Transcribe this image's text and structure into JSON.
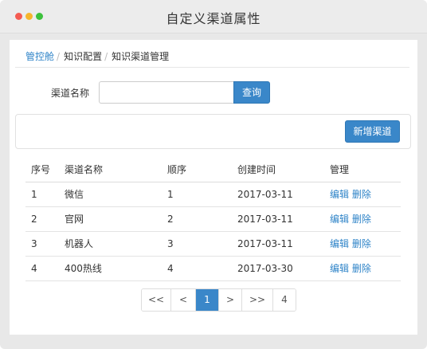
{
  "window": {
    "title": "自定义渠道属性"
  },
  "breadcrumb": {
    "home": "管控舱",
    "sep": "/",
    "level1": "知识配置",
    "current": "知识渠道管理"
  },
  "search": {
    "label": "渠道名称",
    "value": "",
    "placeholder": "",
    "button": "查询"
  },
  "toolbar": {
    "add_label": "新增渠道"
  },
  "table": {
    "headers": [
      "序号",
      "渠道名称",
      "顺序",
      "创建时间",
      "管理"
    ],
    "rows": [
      {
        "no": "1",
        "name": "微信",
        "order": "1",
        "created": "2017-03-11",
        "edit": "编辑",
        "delete": "删除"
      },
      {
        "no": "2",
        "name": "官网",
        "order": "2",
        "created": "2017-03-11",
        "edit": "编辑",
        "delete": "删除"
      },
      {
        "no": "3",
        "name": "机器人",
        "order": "3",
        "created": "2017-03-11",
        "edit": "编辑",
        "delete": "删除"
      },
      {
        "no": "4",
        "name": "400热线",
        "order": "4",
        "created": "2017-03-30",
        "edit": "编辑",
        "delete": "删除"
      }
    ]
  },
  "pagination": {
    "first": "<<",
    "prev": "<",
    "current": "1",
    "next": ">",
    "last": ">>",
    "total": "4"
  },
  "colors": {
    "accent": "#3a87c9",
    "link": "#2f84c8",
    "traffic_red": "#f45b51",
    "traffic_yellow": "#f6b52c",
    "traffic_green": "#3dc13d"
  }
}
